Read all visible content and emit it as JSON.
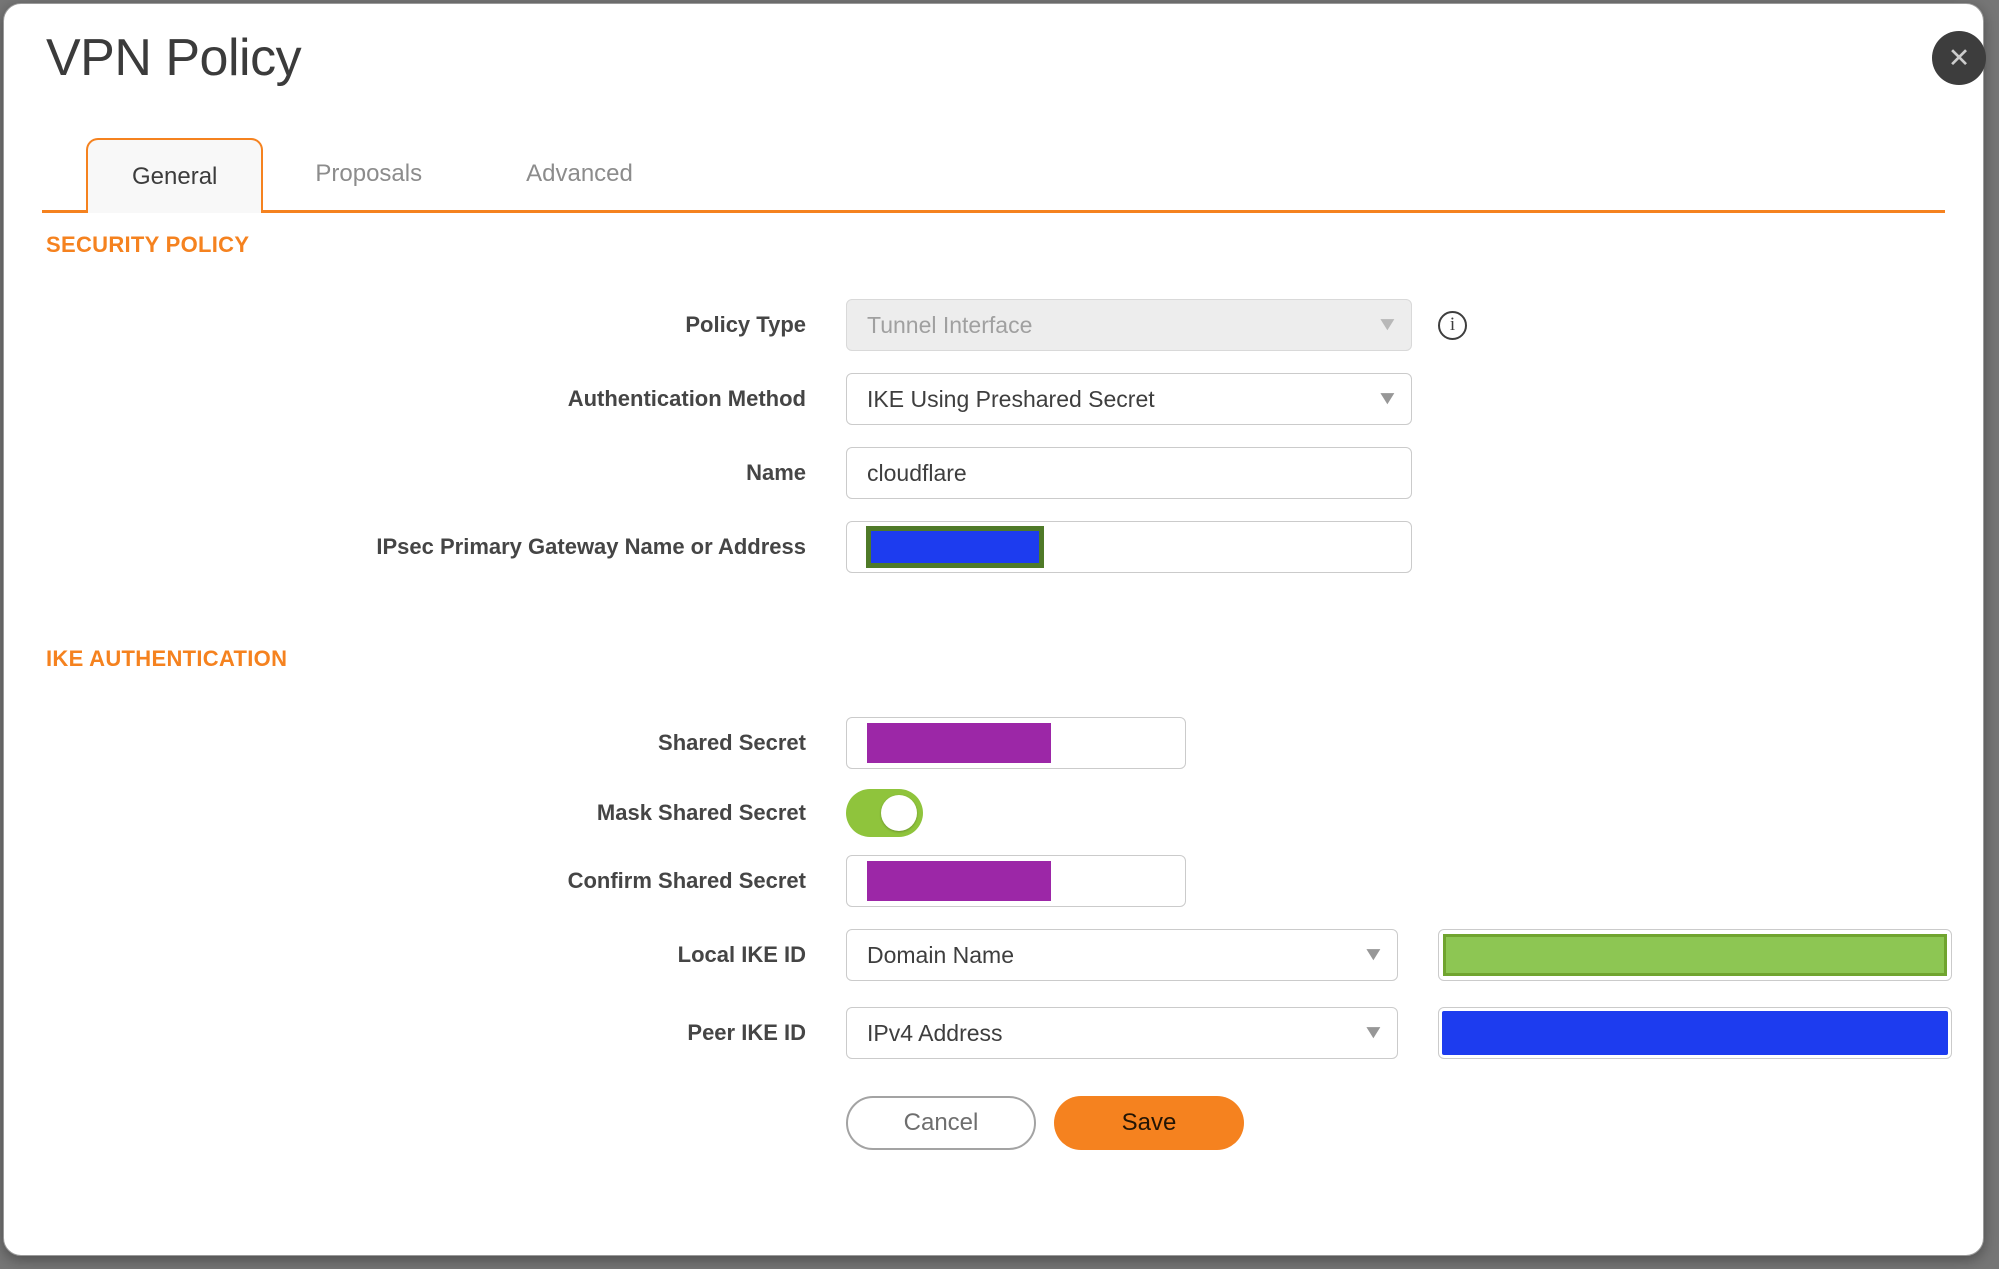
{
  "dialog": {
    "title": "VPN Policy"
  },
  "icons": {
    "close": "✕",
    "caret": "▼",
    "info": "i"
  },
  "tabs": [
    {
      "label": "General",
      "active": true
    },
    {
      "label": "Proposals",
      "active": false
    },
    {
      "label": "Advanced",
      "active": false
    }
  ],
  "sections": {
    "security_policy": "SECURITY POLICY",
    "ike_authentication": "IKE AUTHENTICATION"
  },
  "fields": {
    "policy_type": {
      "label": "Policy Type",
      "value": "Tunnel Interface",
      "disabled": true
    },
    "authentication_method": {
      "label": "Authentication Method",
      "value": "IKE Using Preshared Secret"
    },
    "name": {
      "label": "Name",
      "value": "cloudflare"
    },
    "ipsec_gateway": {
      "label": "IPsec Primary Gateway Name or Address",
      "value_redacted": true
    },
    "shared_secret": {
      "label": "Shared Secret",
      "value_redacted": true
    },
    "mask_shared_secret": {
      "label": "Mask Shared Secret",
      "enabled": true
    },
    "confirm_shared_secret": {
      "label": "Confirm Shared Secret",
      "value_redacted": true
    },
    "local_ike_id": {
      "label": "Local IKE ID",
      "value": "Domain Name",
      "id_value_redacted": true
    },
    "peer_ike_id": {
      "label": "Peer IKE ID",
      "value": "IPv4 Address",
      "id_value_redacted": true
    }
  },
  "buttons": {
    "cancel": "Cancel",
    "save": "Save"
  },
  "colors": {
    "accent_orange": "#F5821F",
    "toggle_green": "#8FC43C",
    "secret_redaction_purple": "#9C27A7",
    "address_redaction_blue": "#1D3CEF",
    "gateway_redaction_border_green": "#4F7A28",
    "local_id_redaction_green": "#8DC653",
    "local_id_redaction_border_green": "#70A42F"
  }
}
